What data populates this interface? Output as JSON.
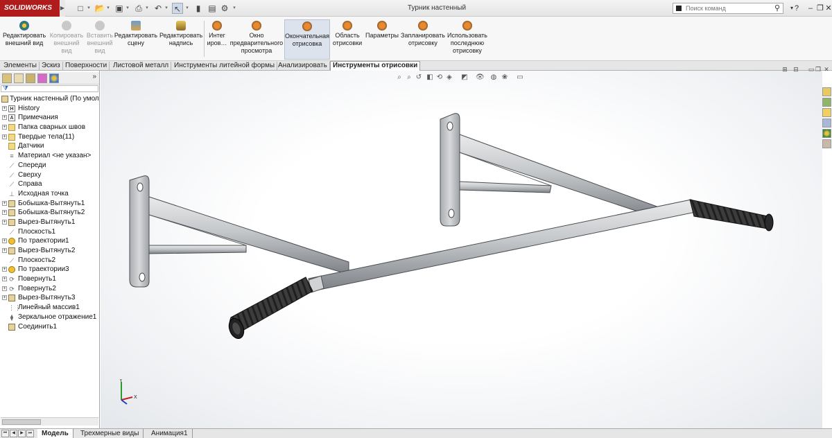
{
  "app": {
    "name": "SOLIDWORKS",
    "document_title": "Турник настенный"
  },
  "search": {
    "placeholder": "Поиск команд"
  },
  "ribbon": {
    "buttons": [
      {
        "label": "Редактировать\nвнешний вид",
        "enabled": true
      },
      {
        "label": "Копировать\nвнешний\nвид",
        "enabled": false
      },
      {
        "label": "Вставить\nвнешний\nвид",
        "enabled": false
      },
      {
        "label": "Редактировать\nсцену",
        "enabled": true
      },
      {
        "label": "Редактировать\nнадпись",
        "enabled": true
      },
      {
        "label": "Интег\nиров…",
        "enabled": true
      },
      {
        "label": "Окно\nпредварительного\nпросмотра",
        "enabled": true
      },
      {
        "label": "Окончательная\nотрисовка",
        "enabled": true,
        "active": true
      },
      {
        "label": "Область\nотрисовки",
        "enabled": true
      },
      {
        "label": "Параметры",
        "enabled": true
      },
      {
        "label": "Запланировать\nотрисовку",
        "enabled": true
      },
      {
        "label": "Использовать\nпоследнюю\nотрисовку",
        "enabled": true
      }
    ]
  },
  "tabs": [
    {
      "label": "Элементы",
      "active": false
    },
    {
      "label": "Эскиз",
      "active": false
    },
    {
      "label": "Поверхности",
      "active": false
    },
    {
      "label": "Листовой металл",
      "active": false
    },
    {
      "label": "Инструменты литейной формы",
      "active": false
    },
    {
      "label": "Анализировать",
      "active": false
    },
    {
      "label": "Инструменты отрисовки",
      "active": true
    }
  ],
  "feature_tree": {
    "root": "Турник настенный  (По умолч",
    "items": [
      {
        "label": "History",
        "icon": "history-icon",
        "expandable": true
      },
      {
        "label": "Примечания",
        "icon": "annotation-icon",
        "expandable": true
      },
      {
        "label": "Папка сварных швов",
        "icon": "folder-icon",
        "expandable": true
      },
      {
        "label": "Твердые тела(11)",
        "icon": "folder-icon",
        "expandable": true
      },
      {
        "label": "Датчики",
        "icon": "sensor-icon",
        "expandable": false
      },
      {
        "label": "Материал <не указан>",
        "icon": "material-icon",
        "expandable": false
      },
      {
        "label": "Спереди",
        "icon": "plane-icon",
        "expandable": false
      },
      {
        "label": "Сверху",
        "icon": "plane-icon",
        "expandable": false
      },
      {
        "label": "Справа",
        "icon": "plane-icon",
        "expandable": false
      },
      {
        "label": "Исходная точка",
        "icon": "origin-icon",
        "expandable": false
      },
      {
        "label": "Бобышка-Вытянуть1",
        "icon": "extrude-icon",
        "expandable": true
      },
      {
        "label": "Бобышка-Вытянуть2",
        "icon": "extrude-icon",
        "expandable": true
      },
      {
        "label": "Вырез-Вытянуть1",
        "icon": "cut-icon",
        "expandable": true
      },
      {
        "label": "Плоскость1",
        "icon": "plane-icon",
        "expandable": false
      },
      {
        "label": "По траектории1",
        "icon": "sweep-icon",
        "expandable": true
      },
      {
        "label": "Вырез-Вытянуть2",
        "icon": "cut-icon",
        "expandable": true
      },
      {
        "label": "Плоскость2",
        "icon": "plane-icon",
        "expandable": false
      },
      {
        "label": "По траектории3",
        "icon": "sweep-icon",
        "expandable": true
      },
      {
        "label": "Повернуть1",
        "icon": "revolve-icon",
        "expandable": true
      },
      {
        "label": "Повернуть2",
        "icon": "revolve-icon",
        "expandable": true
      },
      {
        "label": "Вырез-Вытянуть3",
        "icon": "cut-icon",
        "expandable": true
      },
      {
        "label": "Линейный массив1",
        "icon": "pattern-icon",
        "expandable": false
      },
      {
        "label": "Зеркальное отражение1",
        "icon": "mirror-icon",
        "expandable": false
      },
      {
        "label": "Соединить1",
        "icon": "combine-icon",
        "expandable": false
      }
    ]
  },
  "bottom_tabs": [
    {
      "label": "Модель",
      "active": true
    },
    {
      "label": "Трехмерные виды",
      "active": false
    },
    {
      "label": "Анимация1",
      "active": false
    }
  ],
  "triad": {
    "x": "X",
    "y": "Y"
  },
  "colors": {
    "logo_bg": "#b01c1c",
    "part_metal": "#b9bcbf",
    "grip": "#3a3a3a"
  }
}
